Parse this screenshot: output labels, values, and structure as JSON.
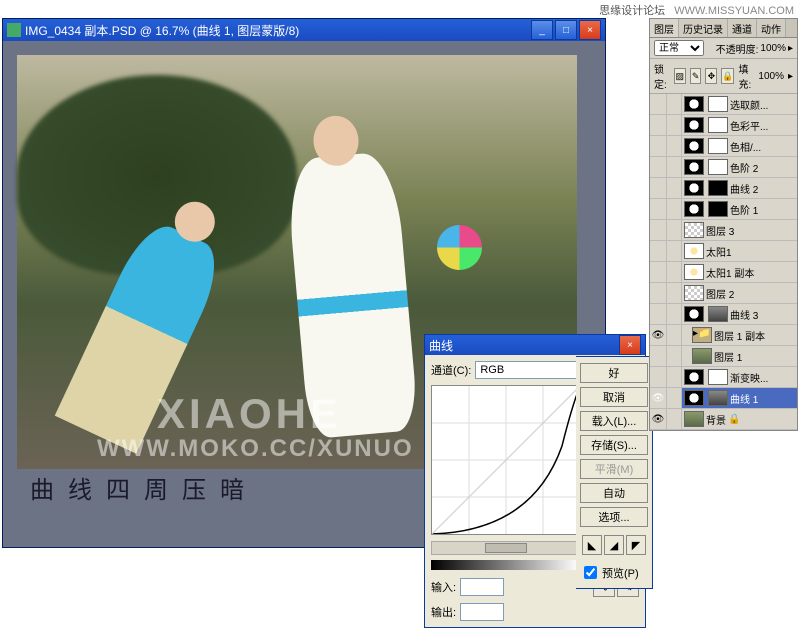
{
  "topbar": {
    "forum": "思缘设计论坛",
    "url": "WWW.MISSYUAN.COM"
  },
  "doc": {
    "title": "IMG_0434 副本.PSD @ 16.7% (曲线 1, 图层蒙版/8)",
    "watermark1": "XIAOHE",
    "watermark2": "WWW.MOKO.CC/XUNUO",
    "caption": "曲线四周压暗"
  },
  "curves": {
    "title": "曲线",
    "channel_label": "通道(C):",
    "channel_value": "RGB",
    "input_label": "输入:",
    "output_label": "输出:",
    "input_value": "",
    "output_value": ""
  },
  "curves_buttons": {
    "ok": "好",
    "cancel": "取消",
    "load": "载入(L)...",
    "save": "存储(S)...",
    "smooth": "平滑(M)",
    "auto": "自动",
    "options": "选项...",
    "preview": "预览(P)"
  },
  "layers": {
    "tabs": [
      "图层",
      "历史记录",
      "通道",
      "动作"
    ],
    "blend": "正常",
    "opacity_label": "不透明度:",
    "opacity_value": "100%",
    "lock_label": "锁定:",
    "fill_label": "填充:",
    "fill_value": "100%",
    "items": [
      {
        "vis": "",
        "adj": true,
        "mask": "mask",
        "name": "选取颜..."
      },
      {
        "vis": "",
        "adj": true,
        "mask": "mask",
        "name": "色彩平..."
      },
      {
        "vis": "",
        "adj": true,
        "mask": "mask",
        "name": "色相/..."
      },
      {
        "vis": "",
        "adj": true,
        "mask": "mask",
        "name": "色阶 2"
      },
      {
        "vis": "",
        "adj": true,
        "mask": "maskb",
        "name": "曲线 2"
      },
      {
        "vis": "",
        "adj": true,
        "mask": "maskb",
        "name": "色阶 1"
      },
      {
        "vis": "",
        "thumb": "check",
        "name": "图层 3"
      },
      {
        "vis": "",
        "thumb": "sun",
        "name": "太阳1"
      },
      {
        "vis": "",
        "thumb": "sun",
        "name": "太阳1 副本"
      },
      {
        "vis": "",
        "thumb": "check",
        "name": "图层 2"
      },
      {
        "vis": "",
        "adj": true,
        "mask": "maskg",
        "name": "曲线 3"
      },
      {
        "vis": "👁",
        "folder": true,
        "name": "图层 1 副本",
        "indent": 1
      },
      {
        "vis": "",
        "thumb": "img",
        "name": "图层 1",
        "indent": 1
      },
      {
        "vis": "",
        "adj": true,
        "mask": "mask",
        "name": "渐变映..."
      },
      {
        "vis": "👁",
        "adj": true,
        "mask": "maskg",
        "name": "曲线 1",
        "sel": true
      },
      {
        "vis": "👁",
        "thumb": "img",
        "name": "背景",
        "lock": true
      }
    ]
  }
}
